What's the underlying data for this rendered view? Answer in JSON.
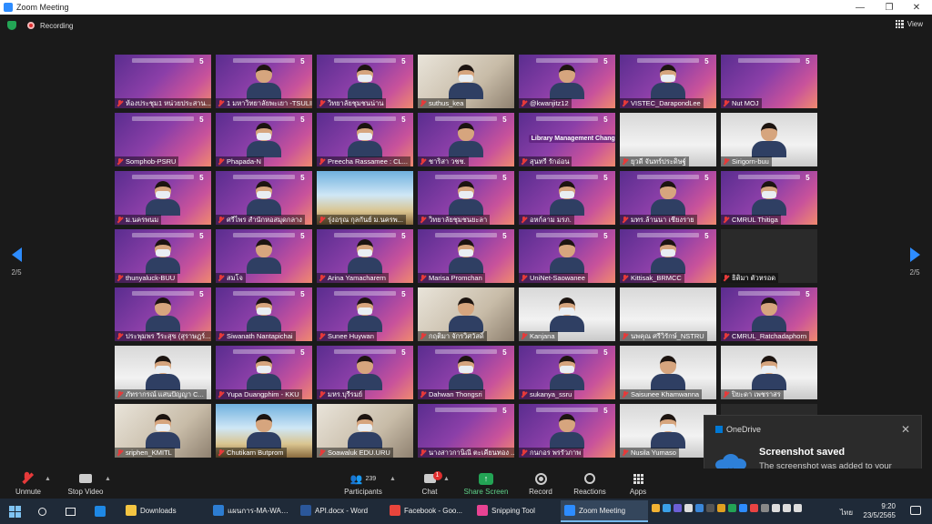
{
  "window": {
    "title": "Zoom Meeting",
    "controls": [
      "—",
      "❐",
      "✕"
    ]
  },
  "topbar": {
    "recording_label": "Recording",
    "view_label": "View"
  },
  "gallery": {
    "page_left": "2/5",
    "page_right": "2/5",
    "participants": [
      {
        "name": "ห้องประชุม1 หน่วยประสาน...",
        "bg": "slide",
        "person": false
      },
      {
        "name": "1 มหาวิทยาลัยพะเยา -TSULIB",
        "bg": "slide",
        "person": true
      },
      {
        "name": "วิทยาลัยชุมชนน่าน",
        "bg": "slide",
        "person": true
      },
      {
        "name": "suthus_kea",
        "bg": "room",
        "person": true
      },
      {
        "name": "@kwanjitz12",
        "bg": "slide",
        "person": true
      },
      {
        "name": "VISTEC_DarapondLee",
        "bg": "slide",
        "person": true
      },
      {
        "name": "Nut MOJ",
        "bg": "slide",
        "person": false
      },
      {
        "name": "Somphob-PSRU",
        "bg": "slide",
        "person": false
      },
      {
        "name": "Phapada-N",
        "bg": "slide",
        "person": true
      },
      {
        "name": "Preecha Rassamee : CL...",
        "bg": "slide",
        "person": true
      },
      {
        "name": "ชาริสา วชช.",
        "bg": "slide",
        "person": true
      },
      {
        "name": "สุนทรี รักอ่อน",
        "bg": "slide",
        "person": false,
        "caption": "Library Management Changed"
      },
      {
        "name": "ยุวดี จันทร์ประดิษฐ์",
        "bg": "office",
        "person": false
      },
      {
        "name": "Sirigorn-buu",
        "bg": "office",
        "person": true
      },
      {
        "name": "ม.นครพนม",
        "bg": "slide",
        "person": true
      },
      {
        "name": "ศรีไพร สำนักหอสมุดกลาง",
        "bg": "slide",
        "person": true
      },
      {
        "name": "รุ่งอรุณ กุลกันย์ ม.นครพ...",
        "bg": "scene",
        "person": false
      },
      {
        "name": "วิทยาลัยชุมชนยะลา",
        "bg": "slide",
        "person": true
      },
      {
        "name": "อหก์ลาม มรภ.",
        "bg": "slide",
        "person": true
      },
      {
        "name": "มทร.ล้านนา เชียงราย",
        "bg": "slide",
        "person": true
      },
      {
        "name": "CMRUL Thitiga",
        "bg": "slide",
        "person": true
      },
      {
        "name": "thunyaluck-BUU",
        "bg": "slide",
        "person": true
      },
      {
        "name": "สมโจ",
        "bg": "slide",
        "person": true
      },
      {
        "name": "Arina Yamacharern",
        "bg": "slide",
        "person": true
      },
      {
        "name": "Marisa Promchan",
        "bg": "slide",
        "person": true
      },
      {
        "name": "UniNet-Saowanee",
        "bg": "slide",
        "person": true
      },
      {
        "name": "Kittisak_BRMCC",
        "bg": "slide",
        "person": true
      },
      {
        "name": "ธิติมา ตัวหรอด",
        "bg": "plain",
        "person": false
      },
      {
        "name": "ประพุมพร วีระสุข (สุราษฎร์...",
        "bg": "slide",
        "person": true
      },
      {
        "name": "Siwanath Nantapichai",
        "bg": "slide",
        "person": true
      },
      {
        "name": "Sunee Huywan",
        "bg": "slide",
        "person": true
      },
      {
        "name": "กฤติมา จักรวิศวัสดิ์",
        "bg": "room",
        "person": true
      },
      {
        "name": "Kanjana",
        "bg": "office",
        "person": true
      },
      {
        "name": "นพคุณ ศรีวิรักษ์_NSTRU",
        "bg": "office",
        "person": false
      },
      {
        "name": "CMRUL_Ratchadaphorn",
        "bg": "slide",
        "person": true
      },
      {
        "name": "ภัทรากรณ์ แสนปัญญา C...",
        "bg": "office",
        "person": true
      },
      {
        "name": "Yupa Duangphim - KKU",
        "bg": "slide",
        "person": true
      },
      {
        "name": "มหร.บุรีรมย์",
        "bg": "slide",
        "person": true
      },
      {
        "name": "Dahwan Thongsri",
        "bg": "slide",
        "person": true
      },
      {
        "name": "sukanya_ssru",
        "bg": "slide",
        "person": true
      },
      {
        "name": "Saisunee Khamwanna",
        "bg": "office",
        "person": true
      },
      {
        "name": "ปิยะดา เพชราสร",
        "bg": "office",
        "person": true
      },
      {
        "name": "sriphen_KMITL",
        "bg": "room",
        "person": true
      },
      {
        "name": "Chutikarn Butprom",
        "bg": "scene",
        "person": true
      },
      {
        "name": "Soawaluk EDU.URU",
        "bg": "room",
        "person": true
      },
      {
        "name": "นางสาวกานิณี ตะเคียนทอง ...",
        "bg": "slide",
        "person": false
      },
      {
        "name": "กนกอร พรรัวภาพ",
        "bg": "slide",
        "person": true
      },
      {
        "name": "Nusila Yumaso",
        "bg": "office",
        "person": true
      },
      {
        "name": "",
        "bg": "plain",
        "person": false
      }
    ]
  },
  "toast": {
    "app_name": "OneDrive",
    "title": "Screenshot saved",
    "message": "The screenshot was added to your OneDrive."
  },
  "controls": {
    "unmute": "Unmute",
    "stop_video": "Stop Video",
    "participants": "Participants",
    "participant_count": "239",
    "chat": "Chat",
    "chat_badge": "1",
    "share_screen": "Share Screen",
    "record": "Record",
    "reactions": "Reactions",
    "apps": "Apps"
  },
  "taskbar": {
    "items": [
      {
        "label": "Downloads",
        "color": "#f4c542"
      },
      {
        "label": "แผนการ-MA-WAL...",
        "color": "#2d7dd2"
      },
      {
        "label": "API.docx - Word",
        "color": "#2b579a"
      },
      {
        "label": "Facebook - Goo...",
        "color": "#e8453c"
      },
      {
        "label": "Snipping Tool",
        "color": "#e84393"
      },
      {
        "label": "Zoom Meeting",
        "color": "#2d8cff"
      }
    ],
    "lang": "ไทย",
    "time": "9:20",
    "date": "23/5/2565"
  },
  "colors": {
    "accent": "#2d8cff",
    "share_green": "#23a455",
    "mute_red": "#e63a3a"
  }
}
